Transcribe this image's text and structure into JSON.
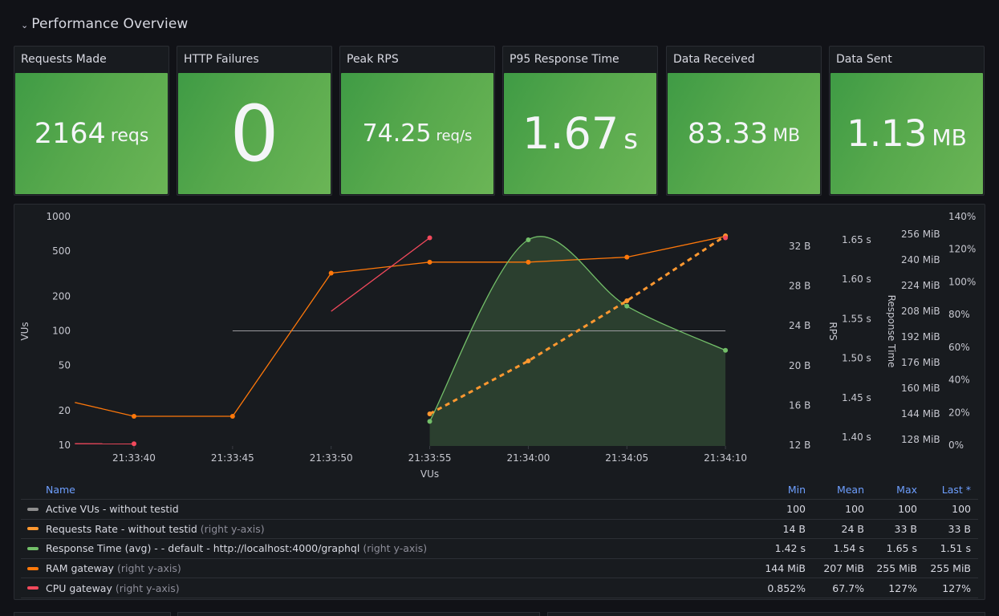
{
  "row": {
    "title": "Performance Overview",
    "chevron_icon": "chevron-down-icon"
  },
  "stats": [
    {
      "title": "Requests Made",
      "value": "2164",
      "unit": "reqs"
    },
    {
      "title": "HTTP Failures",
      "value": "0",
      "unit": ""
    },
    {
      "title": "Peak RPS",
      "value": "74.25",
      "unit": "req/s"
    },
    {
      "title": "P95 Response Time",
      "value": "1.67",
      "unit": "s"
    },
    {
      "title": "Data Received",
      "value": "83.33",
      "unit": "MB"
    },
    {
      "title": "Data Sent",
      "value": "1.13",
      "unit": "MB"
    }
  ],
  "colors": {
    "stat_green": "#56a84c",
    "active_vus": "#8e8e8e",
    "requests_rate": "#ff9830",
    "response_time": "#73bf69",
    "ram_gateway": "#ff780a",
    "cpu_gateway": "#f2495c",
    "legend_header": "#6e9fff"
  },
  "chart_data": {
    "type": "line",
    "x": [
      "21:33:37",
      "21:33:40",
      "21:33:45",
      "21:33:50",
      "21:33:55",
      "21:34:00",
      "21:34:05",
      "21:34:10"
    ],
    "x_ticks": [
      "21:33:40",
      "21:33:45",
      "21:33:50",
      "21:33:55",
      "21:34:00",
      "21:34:05",
      "21:34:10"
    ],
    "xlabel": "VUs",
    "axes": {
      "left": {
        "label": "VUs",
        "scale": "log",
        "range": [
          10,
          1000
        ],
        "ticks": [
          "1000",
          "500",
          "200",
          "100",
          "50",
          "20",
          "10"
        ],
        "tick_values": [
          1000,
          500,
          200,
          100,
          50,
          20,
          10
        ]
      },
      "rps": {
        "label": "RPS",
        "unit": "B",
        "range": [
          12,
          32
        ],
        "ticks": [
          "32 B",
          "28 B",
          "24 B",
          "20 B",
          "16 B",
          "12 B"
        ],
        "tick_values": [
          32,
          28,
          24,
          20,
          16,
          12
        ]
      },
      "response_time": {
        "label": "Response Time",
        "unit": "s",
        "range": [
          1.4,
          1.65
        ],
        "ticks": [
          "1.65 s",
          "1.60 s",
          "1.55 s",
          "1.50 s",
          "1.45 s",
          "1.40 s"
        ],
        "tick_values": [
          1.65,
          1.6,
          1.55,
          1.5,
          1.45,
          1.4
        ]
      },
      "ram": {
        "label": "",
        "unit": "MiB",
        "range": [
          128,
          256
        ],
        "ticks": [
          "256 MiB",
          "240 MiB",
          "224 MiB",
          "208 MiB",
          "192 MiB",
          "176 MiB",
          "160 MiB",
          "144 MiB",
          "128 MiB"
        ],
        "tick_values": [
          256,
          240,
          224,
          208,
          192,
          176,
          160,
          144,
          128
        ]
      },
      "cpu": {
        "label": "",
        "unit": "%",
        "range": [
          0,
          140
        ],
        "ticks": [
          "140%",
          "120%",
          "100%",
          "80%",
          "60%",
          "40%",
          "20%",
          "0%"
        ],
        "tick_values": [
          140,
          120,
          100,
          80,
          60,
          40,
          20,
          0
        ]
      }
    },
    "series": [
      {
        "key": "active_vus",
        "name": "Active VUs - without testid",
        "axis": "left",
        "style": "thin",
        "points": [
          [
            "21:33:45",
            100
          ],
          [
            "21:34:10",
            100
          ]
        ]
      },
      {
        "key": "requests_rate",
        "name": "Requests Rate - without testid",
        "axis": "rps",
        "style": "solid-points",
        "points": [
          [
            "21:33:37",
            16.3
          ],
          [
            "21:33:40",
            14.9
          ],
          [
            "21:33:45",
            14.9
          ],
          [
            "21:33:50",
            29.3
          ],
          [
            "21:33:55",
            30.4
          ],
          [
            "21:34:00",
            30.4
          ],
          [
            "21:34:05",
            30.9
          ],
          [
            "21:34:10",
            33
          ]
        ]
      },
      {
        "key": "response_time",
        "name": "Response Time (avg) - - default - http://localhost:4000/graphql",
        "axis": "response_time",
        "style": "smooth-fill",
        "points": [
          [
            "21:33:55",
            1.42
          ],
          [
            "21:34:00",
            1.65
          ],
          [
            "21:34:05",
            1.566
          ],
          [
            "21:34:10",
            1.51
          ]
        ]
      },
      {
        "key": "ram_gateway",
        "name": "RAM gateway",
        "axis": "ram",
        "style": "dashed",
        "points": [
          [
            "21:33:55",
            144
          ],
          [
            "21:34:00",
            177
          ],
          [
            "21:34:05",
            214.5
          ],
          [
            "21:34:10",
            255
          ]
        ]
      },
      {
        "key": "cpu_gateway",
        "name": "CPU gateway",
        "axis": "cpu",
        "style": "solid-points",
        "segments": [
          [
            [
              "21:33:37",
              0.9
            ],
            [
              "21:33:40",
              0.852
            ]
          ],
          [
            [
              "21:33:50",
              82
            ],
            [
              "21:33:55",
              127
            ]
          ],
          [
            [
              "21:34:10",
              127
            ]
          ]
        ]
      }
    ]
  },
  "legend": {
    "headers": {
      "name": "Name",
      "min": "Min",
      "mean": "Mean",
      "max": "Max",
      "last": "Last *"
    },
    "rows": [
      {
        "key": "active_vus",
        "name": "Active VUs - without testid",
        "hint": "",
        "min": "100",
        "mean": "100",
        "max": "100",
        "last": "100"
      },
      {
        "key": "requests_rate",
        "name": "Requests Rate - without testid",
        "hint": "(right y-axis)",
        "min": "14 B",
        "mean": "24 B",
        "max": "33 B",
        "last": "33 B"
      },
      {
        "key": "response_time",
        "name": "Response Time (avg) - - default - http://localhost:4000/graphql",
        "hint": "(right y-axis)",
        "min": "1.42 s",
        "mean": "1.54 s",
        "max": "1.65 s",
        "last": "1.51 s"
      },
      {
        "key": "ram_gateway",
        "name": "RAM gateway",
        "hint": "(right y-axis)",
        "min": "144 MiB",
        "mean": "207 MiB",
        "max": "255 MiB",
        "last": "255 MiB"
      },
      {
        "key": "cpu_gateway",
        "name": "CPU gateway",
        "hint": "(right y-axis)",
        "min": "0.852%",
        "mean": "67.7%",
        "max": "127%",
        "last": "127%"
      }
    ]
  }
}
